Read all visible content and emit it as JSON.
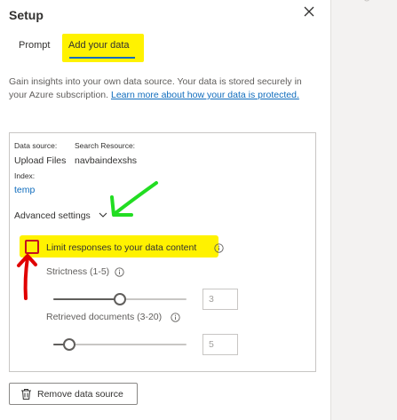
{
  "panel": {
    "title": "Setup",
    "close_icon": "close-icon"
  },
  "tabs": [
    {
      "label": "Prompt",
      "selected": false
    },
    {
      "label": "Add your data",
      "selected": true
    }
  ],
  "description": {
    "text": "Gain insights into your own data source. Your data is stored securely in your Azure subscription. ",
    "link": "Learn more about how your data is protected."
  },
  "source": {
    "data_source_label": "Data source:",
    "data_source_value": "Upload Files",
    "search_resource_label": "Search Resource:",
    "search_resource_value": "navbaindexshs",
    "index_label": "Index:",
    "index_value": "temp"
  },
  "advanced": {
    "label": "Advanced settings",
    "limit_label": "Limit responses to your data content",
    "limit_checked": false,
    "strictness_label": "Strictness (1-5)",
    "strictness_value": "3",
    "strictness_level": 3,
    "strictness_range": [
      1,
      5
    ],
    "retrieved_label": "Retrieved documents (3-20)",
    "retrieved_value": "5",
    "retrieved_level": 5,
    "retrieved_range": [
      3,
      20
    ]
  },
  "actions": {
    "remove_label": "Remove data source"
  },
  "colors": {
    "highlight": "#fff200",
    "accent": "#0f6cbd",
    "annotation_green": "#22dd22",
    "annotation_red": "#e00000"
  }
}
